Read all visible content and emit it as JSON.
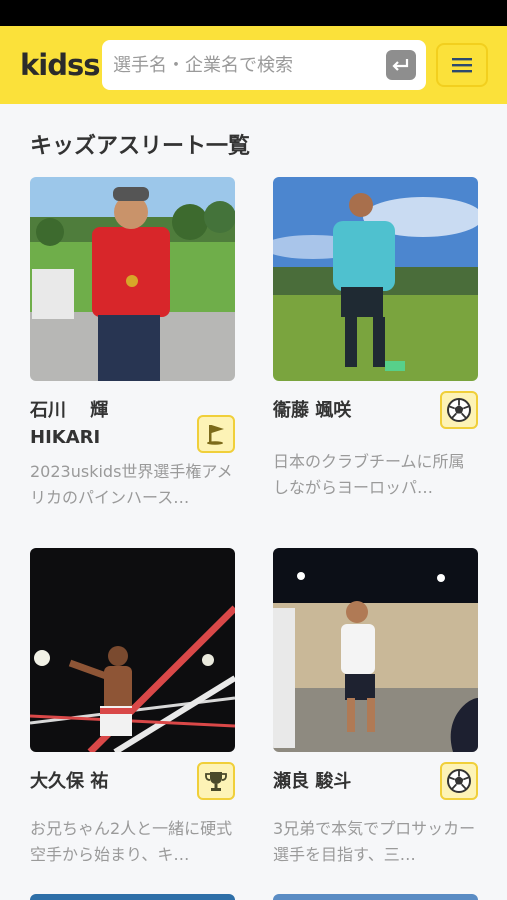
{
  "header": {
    "logo": "kidss",
    "search_placeholder": "選手名・企業名で検索"
  },
  "page_title": "キッズアスリート一覧",
  "athletes": [
    {
      "name": "石川　 輝",
      "name_en": "HIKARI",
      "sport_icon": "golf-flag-icon",
      "description": "2023uskids世界選手権アメリカのパインハース…"
    },
    {
      "name": "衞藤 颯咲",
      "name_en": "",
      "sport_icon": "soccer-ball-icon",
      "description": "日本のクラブチームに所属しながらヨーロッパ…"
    },
    {
      "name": "大久保 祐",
      "name_en": "",
      "sport_icon": "trophy-icon",
      "description": "お兄ちゃん2人と一緒に硬式空手から始まり、キ…"
    },
    {
      "name": "瀬良 駿斗",
      "name_en": "",
      "sport_icon": "soccer-ball-icon",
      "description": "3兄弟で本気でプロサッカー選手を目指す、三…"
    }
  ],
  "colors": {
    "brand": "#fbe13a",
    "badge": "#fdf3b6"
  }
}
